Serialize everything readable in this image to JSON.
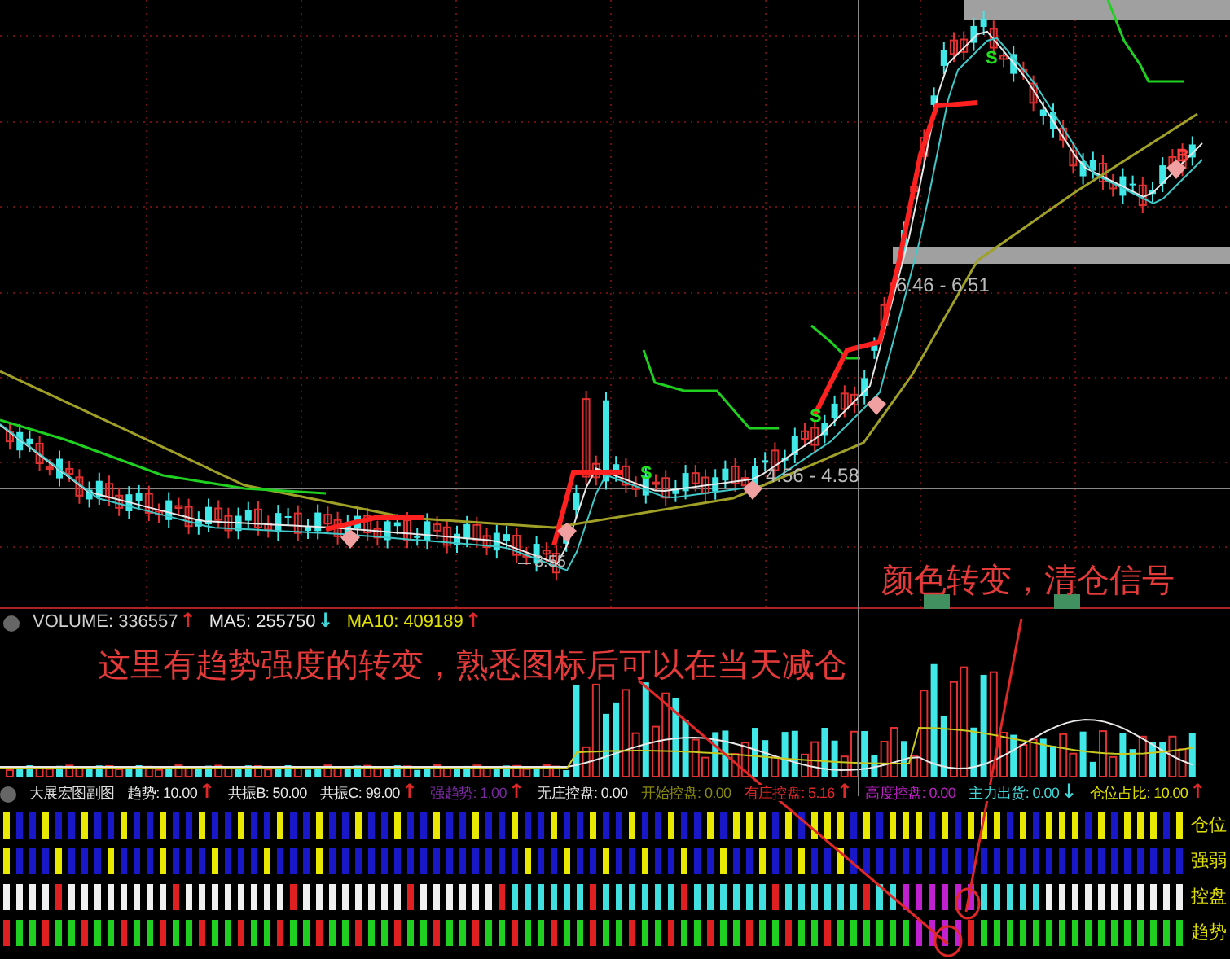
{
  "price_panel": {
    "range_labels": [
      {
        "text": "6.46 - 6.51",
        "kind": "upper"
      },
      {
        "text": "4.56 - 4.58",
        "kind": "lower"
      }
    ],
    "low_label": "3.55",
    "signal_marks": [
      {
        "text": "S",
        "kind": "sell"
      },
      {
        "text": "S",
        "kind": "sell"
      },
      {
        "text": "S",
        "kind": "sell"
      },
      {
        "text": "B",
        "kind": "buy"
      }
    ]
  },
  "volume_legend": [
    {
      "text": "VOLUME: 336557",
      "arrow": {
        "text": "↑",
        "color": "#e02828"
      },
      "color": "#d0d0d0"
    },
    {
      "text": "MA5: 255750",
      "arrow": {
        "text": "↓",
        "color": "#40d8d8"
      },
      "color": "#e8e8e8"
    },
    {
      "text": "MA10: 409189",
      "arrow": {
        "text": "↑",
        "color": "#e02828"
      },
      "color": "#e0e000"
    }
  ],
  "annotations": [
    {
      "text": "这里有趋势强度的转变，熟悉图标后可以在当天减仓",
      "kind": "volume"
    },
    {
      "text": "颜色转变，清仓信号",
      "kind": "price"
    }
  ],
  "indicator": {
    "title": "大展宏图副图",
    "items": [
      {
        "text": "趋势: 10.00",
        "arrow": {
          "text": "↑",
          "color": "#e02828"
        },
        "color": "#e8e8e8"
      },
      {
        "text": "共振B: 50.00",
        "color": "#e8e8e8"
      },
      {
        "text": "共振C: 99.00",
        "arrow": {
          "text": "↑",
          "color": "#e02828"
        },
        "color": "#e8e8e8"
      },
      {
        "text": "强趋势: 1.00",
        "arrow": {
          "text": "↑",
          "color": "#e02828"
        },
        "color": "#7a2aa0"
      },
      {
        "text": "无庄控盘: 0.00",
        "color": "#e8e8e8"
      },
      {
        "text": "开始控盘: 0.00",
        "color": "#8a8a10"
      },
      {
        "text": "有庄控盘: 5.16",
        "arrow": {
          "text": "↑",
          "color": "#e02828"
        },
        "color": "#e02828"
      },
      {
        "text": "高度控盘: 0.00",
        "color": "#c020c8"
      },
      {
        "text": "主力出货: 0.00",
        "arrow": {
          "text": "↓",
          "color": "#40d8d8"
        },
        "color": "#40d8d8"
      },
      {
        "text": "仓位占比: 10.00",
        "arrow": {
          "text": "↑",
          "color": "#e02828"
        },
        "color": "#e0e000"
      }
    ]
  },
  "rows": [
    {
      "label": "仓位",
      "kind": "position"
    },
    {
      "label": "强弱",
      "kind": "strength"
    },
    {
      "label": "控盘",
      "kind": "control"
    },
    {
      "label": "趋势",
      "kind": "trend"
    }
  ]
}
